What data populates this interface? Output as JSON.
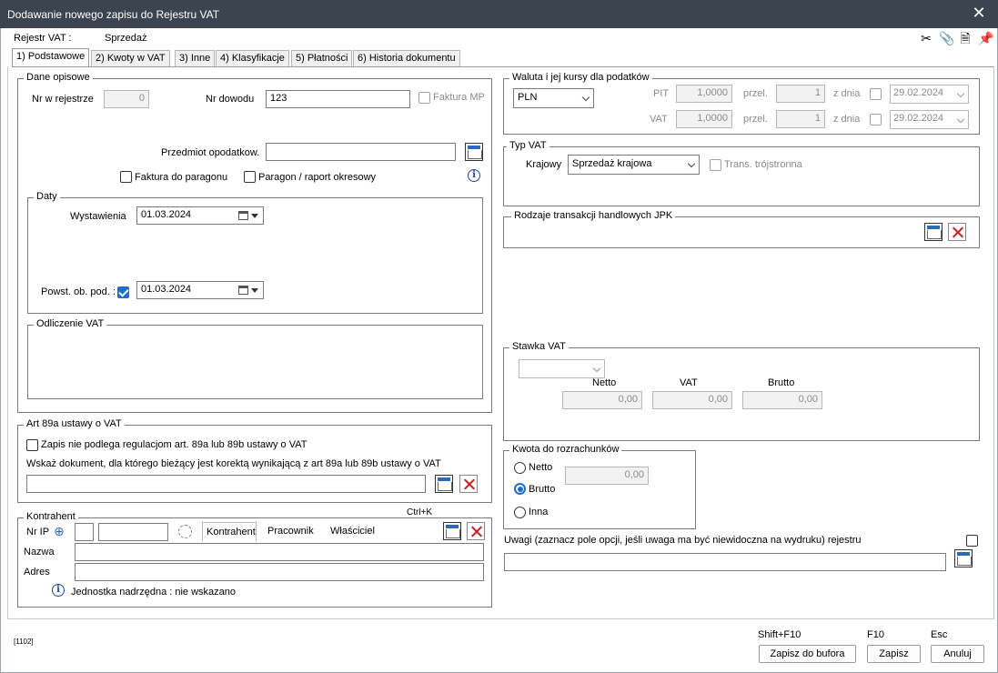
{
  "window": {
    "title": "Dodawanie nowego zapisu do Rejestru VAT"
  },
  "header": {
    "register_label": "Rejestr VAT :",
    "register_value": "Sprzedaż"
  },
  "tabs": [
    {
      "label": "1) Podstawowe"
    },
    {
      "label": "2) Kwoty w VAT"
    },
    {
      "label": "3) Inne"
    },
    {
      "label": "4) Klasyfikacje"
    },
    {
      "label": "5) Płatności"
    },
    {
      "label": "6) Historia dokumentu"
    }
  ],
  "dane": {
    "group_title": "Dane opisowe",
    "nr_rej_label": "Nr w rejestrze",
    "nr_rej_value": "0",
    "nr_dowodu_label": "Nr dowodu",
    "nr_dowodu_value": "123",
    "faktura_mp": "Faktura MP",
    "przedmiot_label": "Przedmiot opodatkow.",
    "przedmiot_value": "",
    "faktura_paragon": "Faktura do paragonu",
    "paragon_raport": "Paragon / raport okresowy",
    "daty": {
      "group_title": "Daty",
      "wyst_label": "Wystawienia",
      "wyst_value": "01.03.2024",
      "powst_label": "Powst. ob. pod. :",
      "powst_value": "01.03.2024"
    },
    "odliczenie_title": "Odliczenie VAT"
  },
  "art89": {
    "group_title": "Art 89a ustawy o VAT",
    "check_label": "Zapis nie podlega regulacjom art. 89a lub 89b ustawy o VAT",
    "info": "Wskaż dokument, dla którego bieżący jest korektą wynikającą z art 89a lub 89b ustawy o VAT",
    "value": ""
  },
  "kontrahent": {
    "group_title": "Kontrahent",
    "shortcut": "Ctrl+K",
    "nrip_label": "Nr IP",
    "tabs": [
      "Kontrahent",
      "Pracownik",
      "Właściciel"
    ],
    "nazwa_label": "Nazwa",
    "adres_label": "Adres",
    "parent_info": "Jednostka nadrzędna : nie wskazano"
  },
  "waluta": {
    "group_title": "Waluta i jej kursy dla podatków",
    "currency": "PLN",
    "pit_label": "PIT",
    "vat_label": "VAT",
    "pit_rate": "1,0000",
    "vat_rate": "1,0000",
    "przel_label": "przel.",
    "pit_przel": "1",
    "vat_przel": "1",
    "zdnia_label": "z dnia",
    "pit_date": "29.02.2024",
    "vat_date": "29.02.2024"
  },
  "typvat": {
    "group_title": "Typ VAT",
    "krajowy_label": "Krajowy",
    "krajowy_value": "Sprzedaż krajowa",
    "trans_label": "Trans. trójstronna"
  },
  "jpk": {
    "group_title": "Rodzaje transakcji handlowych JPK"
  },
  "stawka": {
    "group_title": "Stawka VAT",
    "select_value": "",
    "netto_label": "Netto",
    "vat_label": "VAT",
    "brutto_label": "Brutto",
    "netto": "0,00",
    "vat": "0,00",
    "brutto": "0,00"
  },
  "kwota": {
    "group_title": "Kwota do rozrachunków",
    "netto_label": "Netto",
    "brutto_label": "Brutto",
    "inna_label": "Inna",
    "value": "0,00"
  },
  "uwagi": {
    "label": "Uwagi  (zaznacz pole opcji, jeśli uwaga ma być niewidoczna na wydruku) rejestru",
    "value": ""
  },
  "footer": {
    "code": "[1102]",
    "shortcut_bufor": "Shift+F10",
    "shortcut_zapisz": "F10",
    "shortcut_anuluj": "Esc",
    "bufor_label": "Zapisz do bufora",
    "zapisz_label": "Zapisz",
    "anuluj_label": "Anuluj"
  },
  "colors": {
    "titlebar": "#3c4450",
    "accent": "#1a6fd1",
    "delete": "#d11a1a"
  }
}
